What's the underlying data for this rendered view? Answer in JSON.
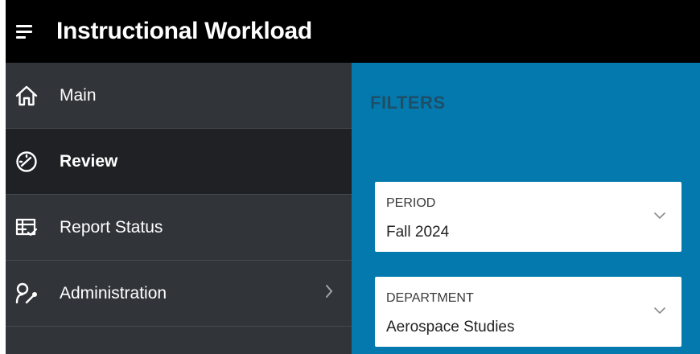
{
  "app": {
    "title": "Instructional Workload"
  },
  "nav": {
    "items": [
      {
        "label": "Main",
        "icon": "home-icon"
      },
      {
        "label": "Review",
        "icon": "gauge-icon",
        "active": true
      },
      {
        "label": "Report Status",
        "icon": "table-check-icon"
      },
      {
        "label": "Administration",
        "icon": "user-wrench-icon",
        "has_children": true
      }
    ]
  },
  "filters": {
    "title": "FILTERS",
    "period": {
      "label": "PERIOD",
      "value": "Fall 2024"
    },
    "department": {
      "label": "DEPARTMENT",
      "value": "Aerospace Studies"
    }
  },
  "colors": {
    "topbar": "#000000",
    "sidebar": "#31353a",
    "sidebar_active": "#1f2124",
    "main": "#0479ad",
    "filters_title": "#1d4f69"
  }
}
